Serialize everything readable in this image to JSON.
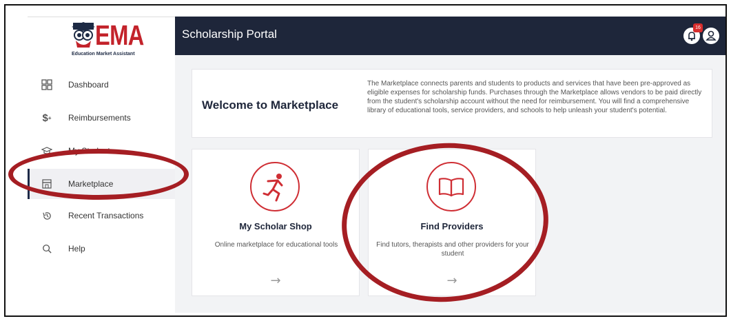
{
  "app": {
    "logo_text": "EMA",
    "logo_tagline": "Education Market Assistant",
    "portal_title": "Scholarship Portal",
    "notification_count": "16"
  },
  "sidebar": {
    "items": [
      {
        "label": "Dashboard",
        "icon": "dashboard-icon"
      },
      {
        "label": "Reimbursements",
        "icon": "dollar-plus-icon"
      },
      {
        "label": "My Students",
        "icon": "graduation-cap-icon"
      },
      {
        "label": "Marketplace",
        "icon": "storefront-icon",
        "active": true
      },
      {
        "label": "Recent Transactions",
        "icon": "history-icon"
      },
      {
        "label": "Help",
        "icon": "search-icon"
      }
    ]
  },
  "welcome": {
    "title": "Welcome to Marketplace",
    "description": "The Marketplace connects parents and students to products and services that have been pre-approved as eligible expenses for scholarship funds. Purchases through the Marketplace allows vendors to be paid directly from the student's scholarship account without the need for reimbursement. You will find a comprehensive library of educational tools, service providers, and schools to help unleash your student's potential."
  },
  "cards": [
    {
      "title": "My Scholar Shop",
      "description": "Online marketplace for educational tools",
      "icon": "running-figure-icon",
      "arrow": "→"
    },
    {
      "title": "Find Providers",
      "description": "Find tutors, therapists and other providers for your student",
      "icon": "open-book-icon",
      "arrow": "→"
    }
  ],
  "colors": {
    "header_bg": "#1e263a",
    "brand_red": "#c3232b",
    "annotation_red": "#a51e23",
    "main_bg": "#f2f3f5"
  }
}
